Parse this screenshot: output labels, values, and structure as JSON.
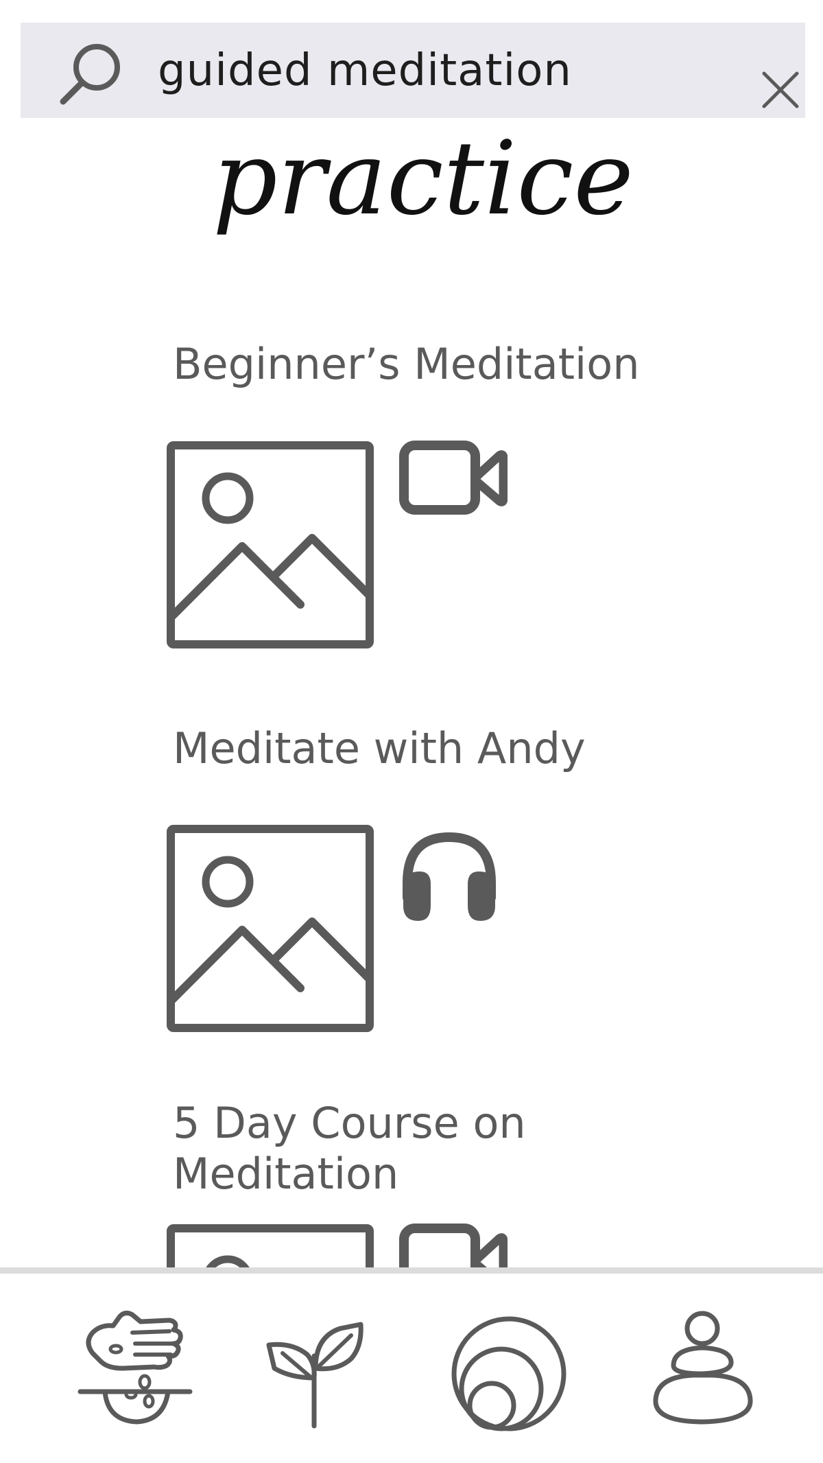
{
  "search": {
    "value": "guided meditation",
    "icon": "search-icon",
    "clear_icon": "close-icon"
  },
  "page": {
    "title": "practice"
  },
  "results": [
    {
      "title": "Beginner’s Meditation",
      "thumbnail_icon": "image-placeholder-icon",
      "media_icon": "video-camera-icon"
    },
    {
      "title": "Meditate with Andy",
      "thumbnail_icon": "image-placeholder-icon",
      "media_icon": "headphones-icon"
    },
    {
      "title": "5 Day Course on Meditation",
      "thumbnail_icon": "image-placeholder-icon",
      "media_icon": "video-camera-icon"
    }
  ],
  "bottom_nav": {
    "items": [
      {
        "icon": "hand-seeds-icon"
      },
      {
        "icon": "sprout-icon"
      },
      {
        "icon": "concentric-circles-icon"
      },
      {
        "icon": "meditating-person-icon"
      }
    ]
  },
  "colors": {
    "search_bar_bg": "#e9e9ef",
    "icon_gray": "#5a5a5a",
    "divider": "#dcdcdc",
    "title_black": "#111111"
  }
}
